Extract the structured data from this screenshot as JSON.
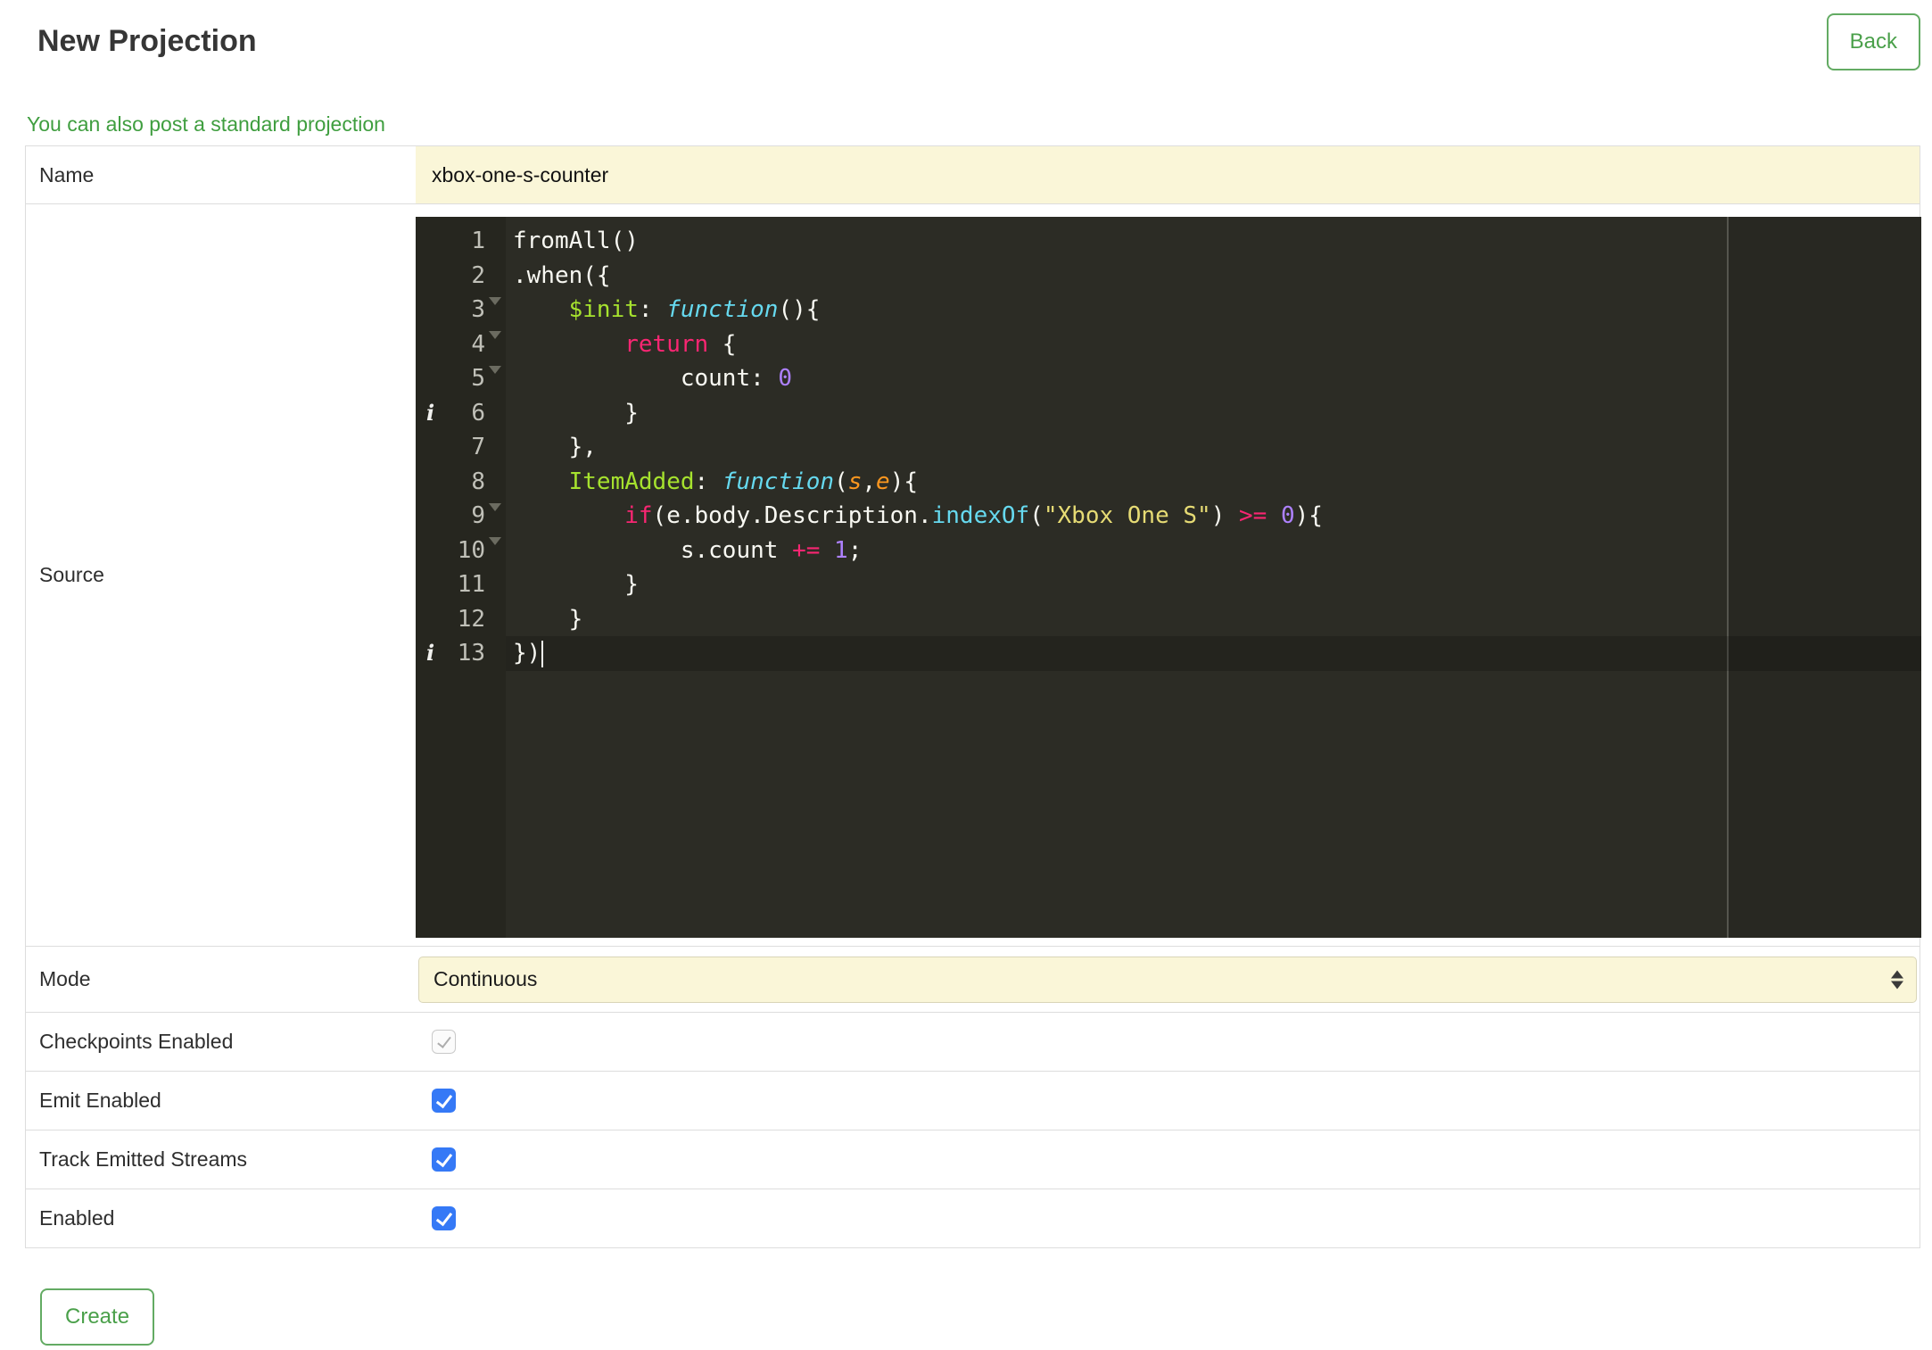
{
  "page": {
    "title": "New Projection",
    "back_button": "Back",
    "standard_projection_link": "You can also post a standard projection",
    "create_button": "Create"
  },
  "colors": {
    "accent_green": "#4aa04a",
    "link_green": "#3f9e3f",
    "field_yellow": "#faf6d8",
    "checkbox_blue": "#3579f6",
    "editor_background": "#2c2c25",
    "editor_gutter": "#26261f",
    "token_keyword": "#f92672",
    "token_function": "#66d9ef",
    "token_param": "#fd971f",
    "token_definition": "#a6e22e",
    "token_number": "#ae81ff",
    "token_string": "#e6db74",
    "token_plain": "#f8f8f2"
  },
  "form": {
    "name": {
      "label": "Name",
      "value": "xbox-one-s-counter"
    },
    "source": {
      "label": "Source"
    },
    "mode": {
      "label": "Mode",
      "value": "Continuous"
    },
    "checkpoints": {
      "label": "Checkpoints Enabled",
      "checked": true,
      "disabled": true
    },
    "emit": {
      "label": "Emit Enabled",
      "checked": true,
      "disabled": false
    },
    "track": {
      "label": "Track Emitted Streams",
      "checked": true,
      "disabled": false
    },
    "enabled": {
      "label": "Enabled",
      "checked": true,
      "disabled": false
    }
  },
  "editor": {
    "info_glyph": "i",
    "lines": [
      {
        "n": 1,
        "fold": false,
        "info": false,
        "active": false,
        "cursor": false,
        "tokens": [
          {
            "c": "plain",
            "t": "fromAll()"
          }
        ]
      },
      {
        "n": 2,
        "fold": true,
        "info": false,
        "active": false,
        "cursor": false,
        "tokens": [
          {
            "c": "plain",
            "t": ".when({"
          }
        ]
      },
      {
        "n": 3,
        "fold": true,
        "info": false,
        "active": false,
        "cursor": false,
        "tokens": [
          {
            "c": "plain",
            "t": "    "
          },
          {
            "c": "def",
            "t": "$init"
          },
          {
            "c": "plain",
            "t": ": "
          },
          {
            "c": "fn",
            "t": "function"
          },
          {
            "c": "plain",
            "t": "(){"
          }
        ]
      },
      {
        "n": 4,
        "fold": true,
        "info": false,
        "active": false,
        "cursor": false,
        "tokens": [
          {
            "c": "plain",
            "t": "        "
          },
          {
            "c": "kw",
            "t": "return"
          },
          {
            "c": "plain",
            "t": " {"
          }
        ]
      },
      {
        "n": 5,
        "fold": false,
        "info": false,
        "active": false,
        "cursor": false,
        "tokens": [
          {
            "c": "plain",
            "t": "            count: "
          },
          {
            "c": "num",
            "t": "0"
          }
        ]
      },
      {
        "n": 6,
        "fold": false,
        "info": true,
        "active": false,
        "cursor": false,
        "tokens": [
          {
            "c": "plain",
            "t": "        }"
          }
        ]
      },
      {
        "n": 7,
        "fold": false,
        "info": false,
        "active": false,
        "cursor": false,
        "tokens": [
          {
            "c": "plain",
            "t": "    },"
          }
        ]
      },
      {
        "n": 8,
        "fold": true,
        "info": false,
        "active": false,
        "cursor": false,
        "tokens": [
          {
            "c": "plain",
            "t": "    "
          },
          {
            "c": "def",
            "t": "ItemAdded"
          },
          {
            "c": "plain",
            "t": ": "
          },
          {
            "c": "fn",
            "t": "function"
          },
          {
            "c": "plain",
            "t": "("
          },
          {
            "c": "param",
            "t": "s"
          },
          {
            "c": "plain",
            "t": ","
          },
          {
            "c": "param",
            "t": "e"
          },
          {
            "c": "plain",
            "t": "){"
          }
        ]
      },
      {
        "n": 9,
        "fold": true,
        "info": false,
        "active": false,
        "cursor": false,
        "tokens": [
          {
            "c": "plain",
            "t": "        "
          },
          {
            "c": "kw",
            "t": "if"
          },
          {
            "c": "plain",
            "t": "(e.body.Description."
          },
          {
            "c": "prop",
            "t": "indexOf"
          },
          {
            "c": "plain",
            "t": "("
          },
          {
            "c": "str",
            "t": "\"Xbox One S\""
          },
          {
            "c": "plain",
            "t": ") "
          },
          {
            "c": "kw",
            "t": ">="
          },
          {
            "c": "plain",
            "t": " "
          },
          {
            "c": "num",
            "t": "0"
          },
          {
            "c": "plain",
            "t": "){"
          }
        ]
      },
      {
        "n": 10,
        "fold": false,
        "info": false,
        "active": false,
        "cursor": false,
        "tokens": [
          {
            "c": "plain",
            "t": "            s.count "
          },
          {
            "c": "kw",
            "t": "+="
          },
          {
            "c": "plain",
            "t": " "
          },
          {
            "c": "num",
            "t": "1"
          },
          {
            "c": "plain",
            "t": ";"
          }
        ]
      },
      {
        "n": 11,
        "fold": false,
        "info": false,
        "active": false,
        "cursor": false,
        "tokens": [
          {
            "c": "plain",
            "t": "        }"
          }
        ]
      },
      {
        "n": 12,
        "fold": false,
        "info": false,
        "active": false,
        "cursor": false,
        "tokens": [
          {
            "c": "plain",
            "t": "    }"
          }
        ]
      },
      {
        "n": 13,
        "fold": false,
        "info": true,
        "active": true,
        "cursor": true,
        "tokens": [
          {
            "c": "plain",
            "t": "})"
          }
        ]
      }
    ]
  }
}
